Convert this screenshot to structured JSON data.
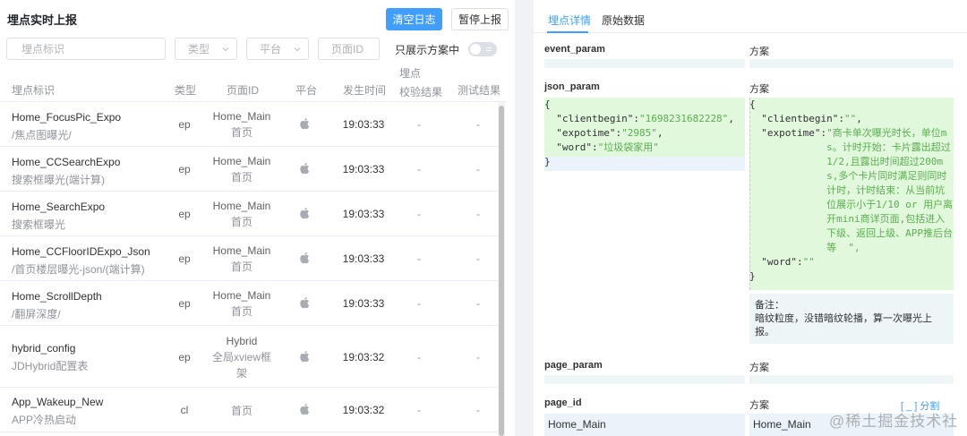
{
  "left": {
    "title": "埋点实时上报",
    "clear_button": "清空日志",
    "pause_button": "暂停上报",
    "filters": {
      "tag_placeholder": "埋点标识",
      "type_placeholder": "类型",
      "platform_placeholder": "平台",
      "page_placeholder": "页面ID",
      "only_scheme_label": "只展示方案中"
    },
    "columns": {
      "tag": "埋点标识",
      "type": "类型",
      "page": "页面ID",
      "platform": "平台",
      "time": "发生时间",
      "validate_line1": "埋点",
      "validate_line2": "校验结果",
      "test": "测试结果"
    },
    "rows": [
      {
        "name": "Home_FocusPic_Expo",
        "desc": "/焦点图曝光/",
        "type": "ep",
        "page": "Home_Main",
        "page_sub": "首页",
        "time": "19:03:33",
        "validate": "-",
        "test": "-"
      },
      {
        "name": "Home_CCSearchExpo",
        "desc": "搜索框曝光(端计算)",
        "type": "ep",
        "page": "Home_Main",
        "page_sub": "首页",
        "time": "19:03:33",
        "validate": "-",
        "test": "-"
      },
      {
        "name": "Home_SearchExpo",
        "desc": "搜索框曝光",
        "type": "ep",
        "page": "Home_Main",
        "page_sub": "首页",
        "time": "19:03:33",
        "validate": "-",
        "test": "-"
      },
      {
        "name": "Home_CCFloorIDExpo_Json",
        "desc": "/首页楼层曝光-json/(端计算)",
        "type": "ep",
        "page": "Home_Main",
        "page_sub": "首页",
        "time": "19:03:33",
        "validate": "-",
        "test": "-"
      },
      {
        "name": "Home_ScrollDepth",
        "desc": "/翻屏深度/",
        "type": "ep",
        "page": "Home_Main",
        "page_sub": "首页",
        "time": "19:03:33",
        "validate": "-",
        "test": "-"
      },
      {
        "name": "hybrid_config",
        "desc": "JDHybrid配置表",
        "type": "ep",
        "page": "Hybrid",
        "page_sub": "全局xview框",
        "page_sub2": "架",
        "time": "19:03:32",
        "validate": "-",
        "test": "-"
      },
      {
        "name": "App_Wakeup_New",
        "desc": "APP冷热启动",
        "type": "cl",
        "page": "",
        "page_sub": "首页",
        "time": "19:03:32",
        "validate": "-",
        "test": "-"
      }
    ]
  },
  "right": {
    "tab_detail": "埋点详情",
    "tab_raw": "原始数据",
    "col2_label": "方案",
    "event_param_label": "event_param",
    "json_param_label": "json_param",
    "page_param_label": "page_param",
    "page_id_label": "page_id",
    "split_link": "[ _ ] 分割",
    "page_id_value_left": "Home_Main",
    "page_id_value_right": "Home_Main",
    "json_left": {
      "open": "{",
      "k1": "\"clientbegin\"",
      "v1": "\"1698231682228\"",
      "k2": "\"expotime\"",
      "v2": "\"2985\"",
      "k3": "\"word\"",
      "v3": "\"垃圾袋家用\"",
      "close": "}"
    },
    "json_right": {
      "open": "{",
      "k1": "\"clientbegin\"",
      "v1": "\"\"",
      "k2": "\"expotime\"",
      "v2_lines": [
        "\"商卡单次曝光时长，单位m",
        "s。计时开始：卡片露出超过",
        "1/2,且露出时间超过200m",
        "s,多个卡片同时满足则同时",
        "计时，计时结束：从当前坑",
        "位展示小于1/10 or 用户离",
        "开mini商详页面,包括进入",
        "下级、返回上级、APP推后台",
        "等  \","
      ],
      "k3": "\"word\"",
      "v3": "\"\"",
      "close": "}"
    },
    "note_title": "备注：",
    "note_line1": "暗纹粒度，没错暗纹轮播，算一次曝光上",
    "note_line2": "报。"
  },
  "watermark": "@稀土掘金技术社区"
}
